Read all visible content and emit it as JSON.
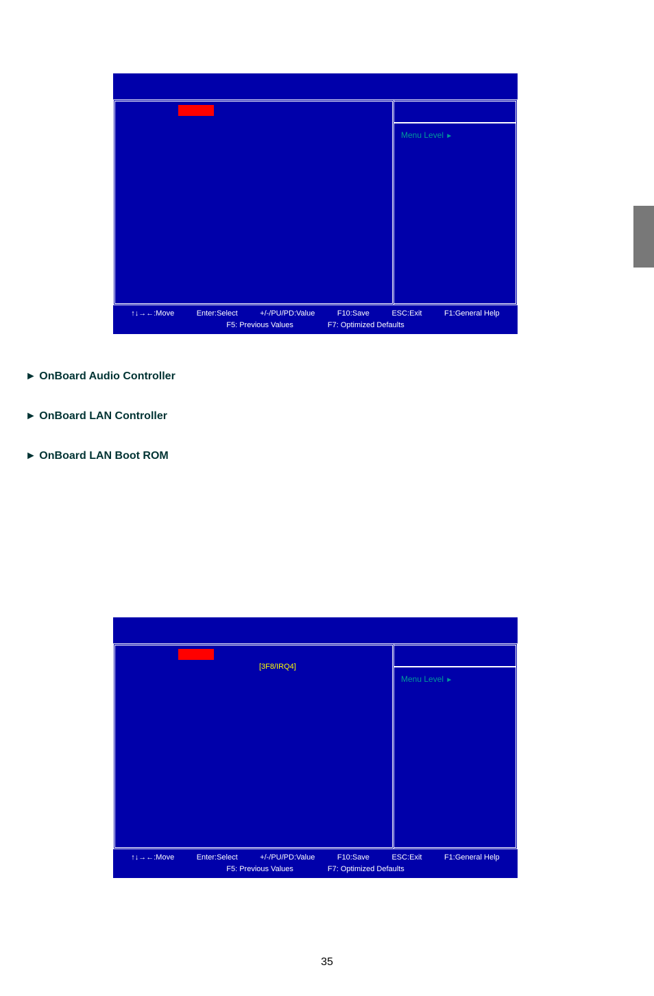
{
  "sideTab": "",
  "biosWindow1": {
    "menuLevel": "Menu Level",
    "footer": {
      "move": "↑↓→←:Move",
      "enter": "Enter:Select",
      "value": "+/-/PU/PD:Value",
      "save": "F10:Save",
      "exit": "ESC:Exit",
      "help": "F1:General Help",
      "previous": "F5: Previous Values",
      "optimized": "F7: Optimized Defaults"
    }
  },
  "biosWindow2": {
    "menuLevel": "Menu Level",
    "serialPort": "[3F8/IRQ4]",
    "footer": {
      "move": "↑↓→←:Move",
      "enter": "Enter:Select",
      "value": "+/-/PU/PD:Value",
      "save": "F10:Save",
      "exit": "ESC:Exit",
      "help": "F1:General Help",
      "previous": "F5: Previous Values",
      "optimized": "F7: Optimized Defaults"
    }
  },
  "headings": {
    "h1": "OnBoard Audio Controller",
    "h2": "OnBoard LAN Controller",
    "h3": "OnBoard LAN Boot ROM"
  },
  "pageNumber": "35",
  "arrow": "►"
}
